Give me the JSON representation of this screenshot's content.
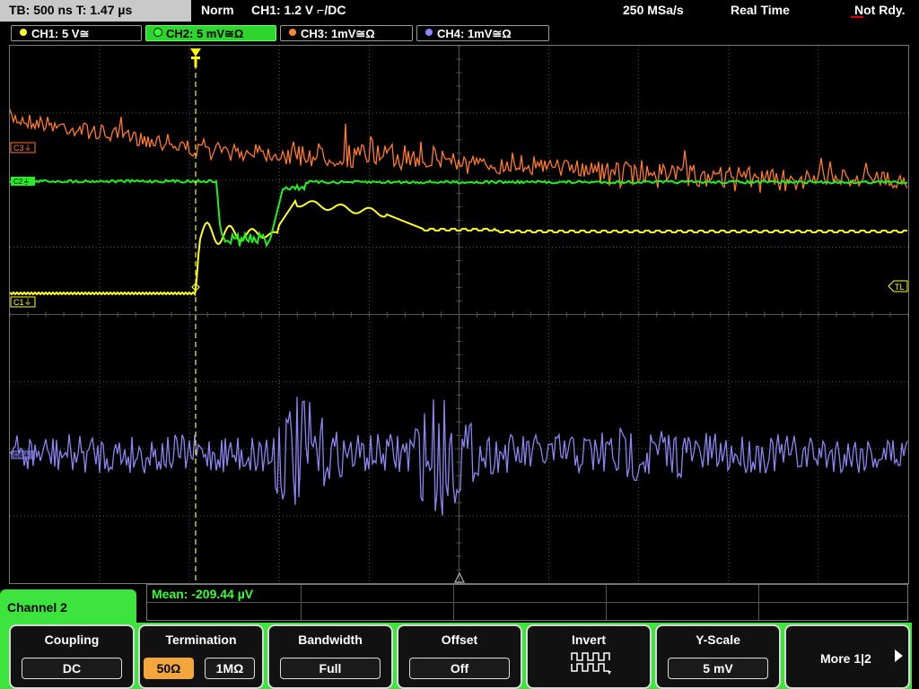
{
  "status": {
    "timebase": "TB: 500 ns   T: 1.47 µs",
    "mode": "Norm",
    "trigger": "CH1: 1.2 V ⌐/DC",
    "sample_rate": "250 MSa/s",
    "acq": "Real Time",
    "state": "Not Rdy."
  },
  "channel_tabs": [
    {
      "label": "CH1: 5 V≅",
      "color": "#ffff33"
    },
    {
      "label": "CH2: 5 mV≅Ω",
      "color": "#33ff33"
    },
    {
      "label": "CH3: 1mV≅Ω",
      "color": "#ff8833"
    },
    {
      "label": "CH4: 1mV≅Ω",
      "color": "#8888ff"
    }
  ],
  "waveform_labels": {
    "c1": "C1⏚",
    "c3": "C3⏚",
    "c2": "C2⏚",
    "c4": "C4⏚",
    "tl": "TL"
  },
  "colors": {
    "ch1": "#ffff22",
    "ch2": "#22ee22",
    "ch3": "#ff7a2a",
    "ch4": "#8c84f0",
    "grid": "#555555",
    "trigger": "#ffff00"
  },
  "measurement": {
    "mean": "Mean: -209.44 µV"
  },
  "panel": {
    "title": "Channel 2"
  },
  "softkeys": {
    "coupling": {
      "title": "Coupling",
      "value": "DC"
    },
    "termination": {
      "title": "Termination",
      "opt1": "50Ω",
      "opt2": "1MΩ"
    },
    "bandwidth": {
      "title": "Bandwidth",
      "value": "Full"
    },
    "offset": {
      "title": "Offset",
      "value": "Off"
    },
    "invert": {
      "title": "Invert"
    },
    "yscale": {
      "title": "Y-Scale",
      "value": "5 mV"
    },
    "more": {
      "label": "More 1|2"
    }
  }
}
